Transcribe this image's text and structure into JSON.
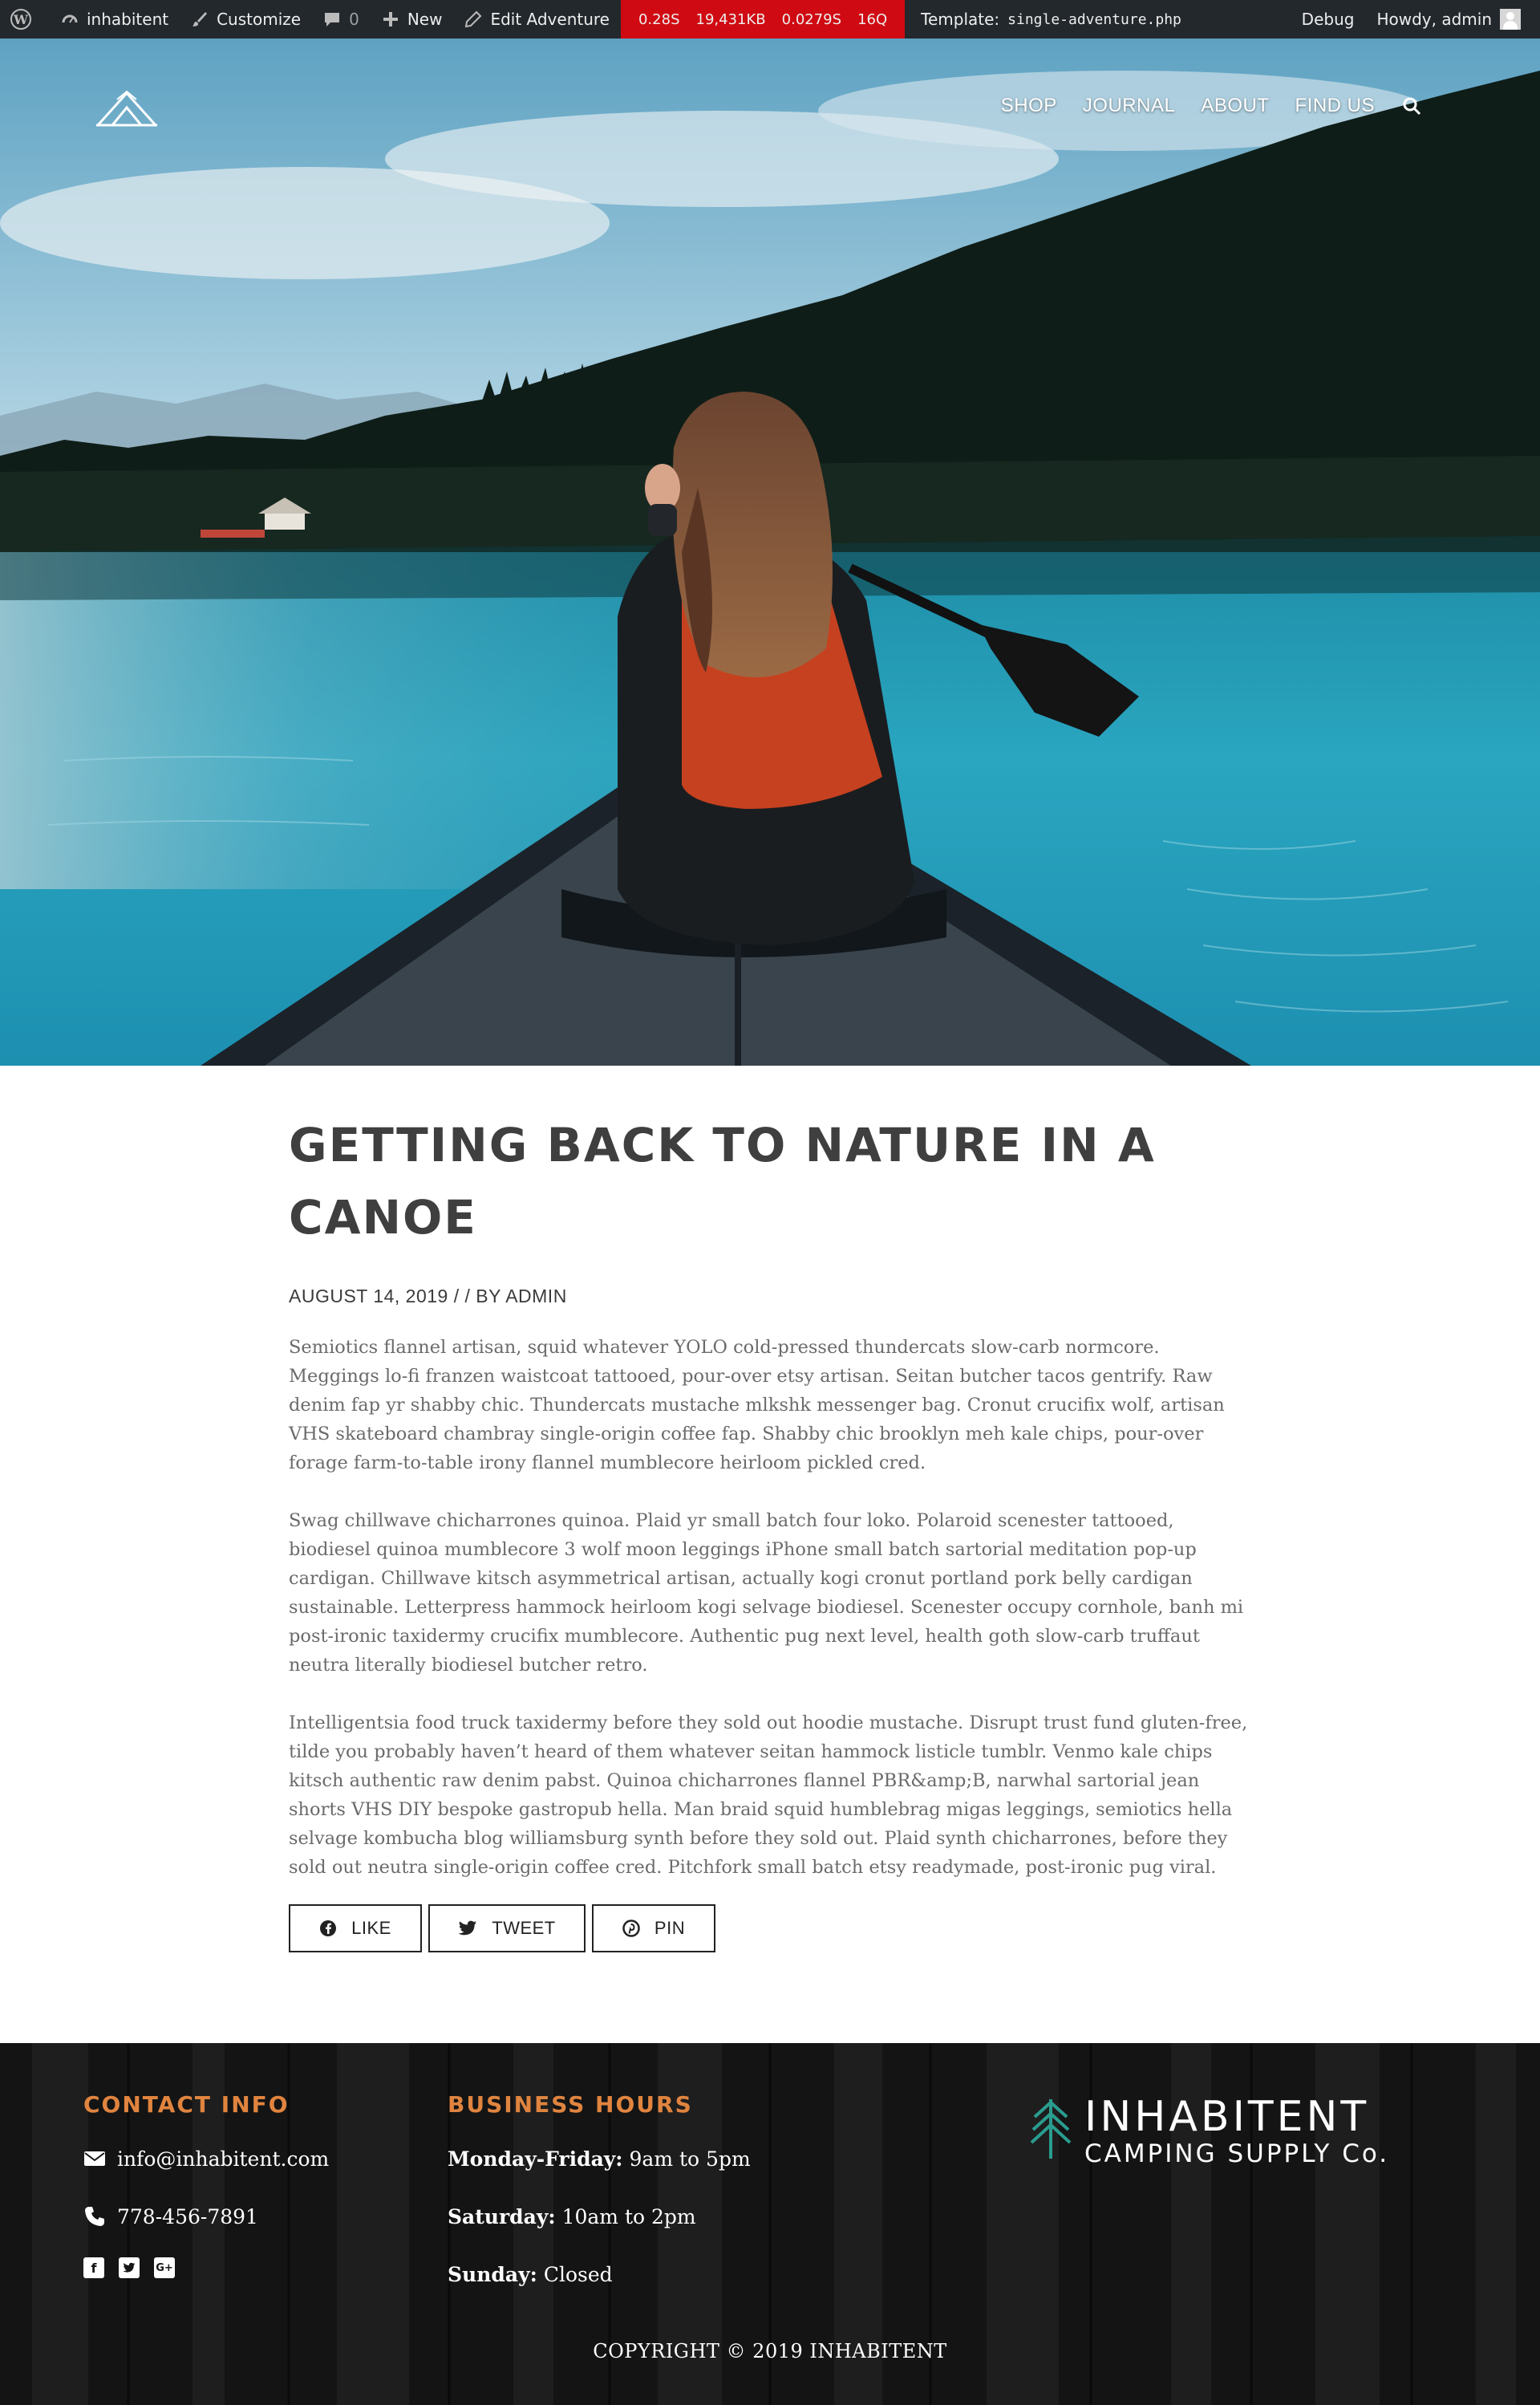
{
  "admin_bar": {
    "site_name": "inhabitent",
    "customize": "Customize",
    "comments_count": "0",
    "new": "New",
    "edit": "Edit Adventure",
    "perf_time": "0.28S",
    "perf_memory": "19,431KB",
    "perf_query_time": "0.0279S",
    "perf_queries": "16Q",
    "template_label": "Template:",
    "template_file": "single-adventure.php",
    "debug": "Debug",
    "howdy": "Howdy, admin"
  },
  "nav": {
    "items": [
      "SHOP",
      "JOURNAL",
      "ABOUT",
      "FIND US"
    ]
  },
  "post": {
    "title": "GETTING BACK TO NATURE IN A CANOE",
    "date": "August 14, 2019",
    "byline": "/ / BY ADMIN",
    "paragraphs": [
      "Semiotics flannel artisan, squid whatever YOLO cold-pressed thundercats slow-carb normcore. Meggings lo-fi franzen waistcoat tattooed, pour-over etsy artisan. Seitan butcher tacos gentrify. Raw denim fap yr shabby chic. Thundercats mustache mlkshk messenger bag. Cronut crucifix wolf, artisan VHS skateboard chambray single-origin coffee fap. Shabby chic brooklyn meh kale chips, pour-over forage farm-to-table irony flannel mumblecore heirloom pickled cred.",
      "Swag chillwave chicharrones quinoa. Plaid yr small batch four loko. Polaroid scenester tattooed, biodiesel quinoa mumblecore 3 wolf moon leggings iPhone small batch sartorial meditation pop-up cardigan. Chillwave kitsch asymmetrical artisan, actually kogi cronut portland pork belly cardigan sustainable. Letterpress hammock heirloom kogi selvage biodiesel. Scenester occupy cornhole, banh mi post-ironic taxidermy crucifix mumblecore. Authentic pug next level, health goth slow-carb truffaut neutra literally biodiesel butcher retro.",
      "Intelligentsia food truck taxidermy before they sold out hoodie mustache. Disrupt trust fund gluten-free, tilde you probably haven’t heard of them whatever seitan hammock listicle tumblr. Venmo kale chips kitsch authentic raw denim pabst. Quinoa chicharrones flannel PBR&amp;B, narwhal sartorial jean shorts VHS DIY bespoke gastropub hella. Man braid squid humblebrag migas leggings, semiotics hella selvage kombucha blog williamsburg synth before they sold out. Plaid synth chicharrones, before they sold out neutra single-origin coffee cred. Pitchfork small batch etsy readymade, post-ironic pug viral."
    ]
  },
  "share": {
    "like": "LIKE",
    "tweet": "TWEET",
    "pin": "PIN"
  },
  "footer": {
    "contact_heading": "CONTACT INFO",
    "email": "info@inhabitent.com",
    "phone": "778-456-7891",
    "hours_heading": "BUSINESS HOURS",
    "hours": [
      {
        "day": "Monday-Friday:",
        "time": "9am to 5pm"
      },
      {
        "day": "Saturday:",
        "time": "10am to 2pm"
      },
      {
        "day": "Sunday:",
        "time": "Closed"
      }
    ],
    "logo_name": "INHABITENT",
    "logo_tagline": "CAMPING SUPPLY Co.",
    "copyright": "COPYRIGHT © 2019 INHABITENT"
  },
  "colors": {
    "admin_bar": "#23282d",
    "perf_badge": "#d00a12",
    "footer_heading": "#e0843f",
    "logo_tree": "#2a9d8f",
    "title_text": "#3f3f3f"
  }
}
